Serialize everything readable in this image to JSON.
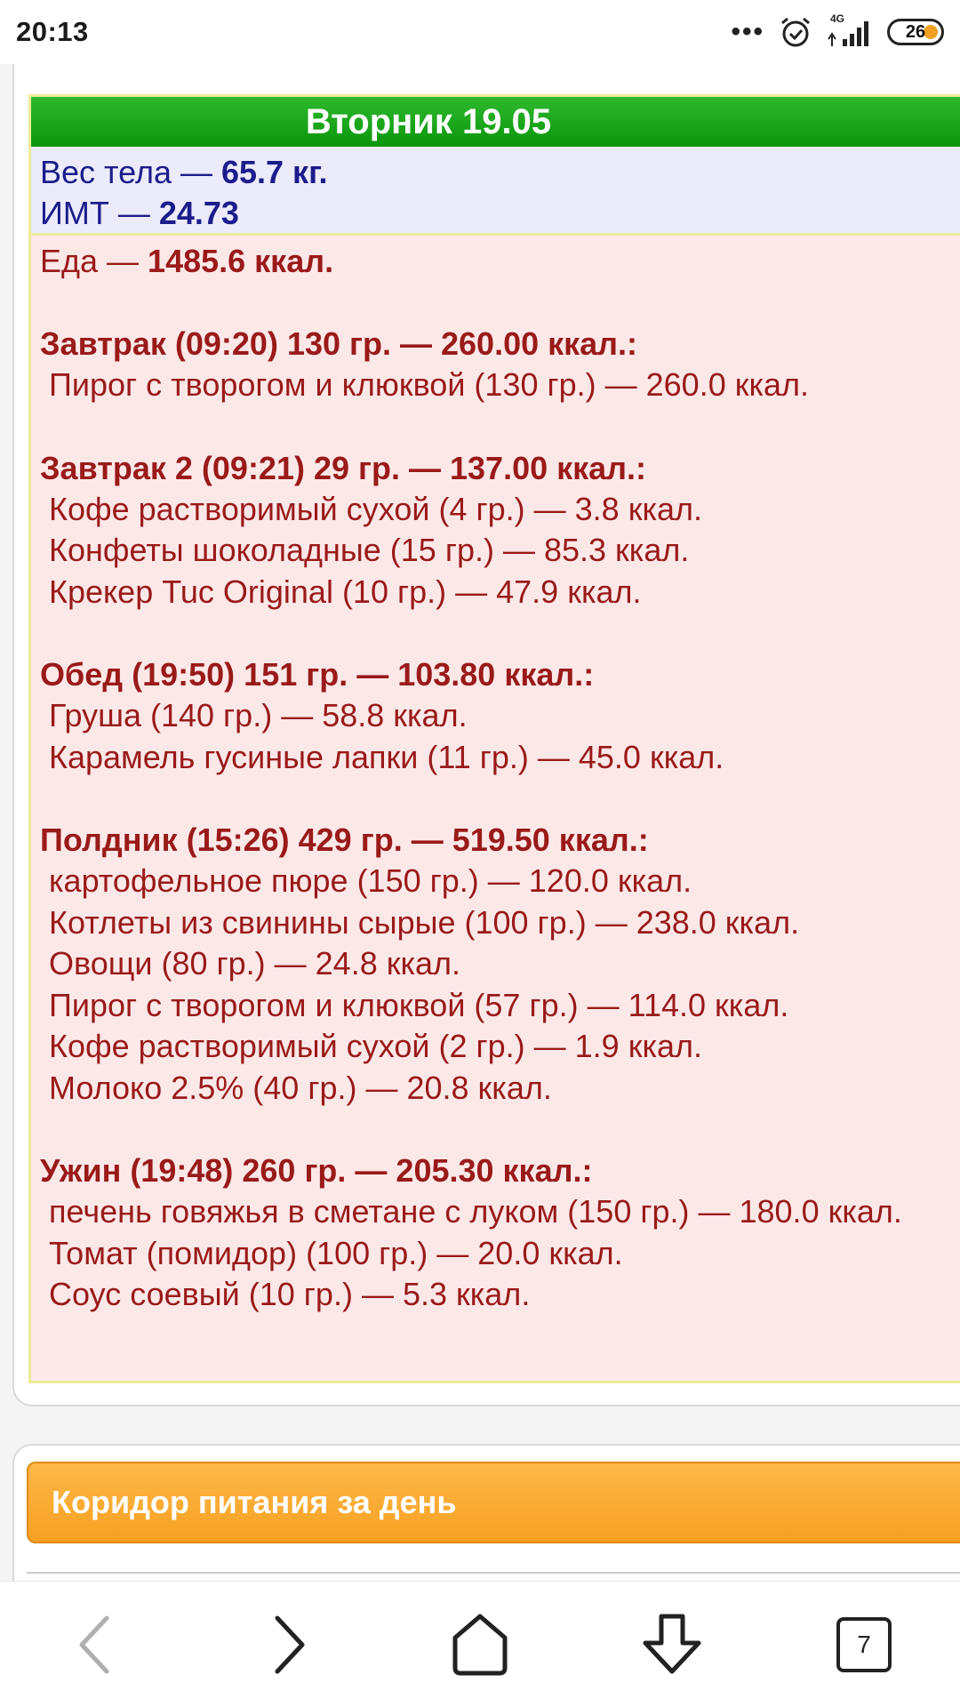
{
  "status_bar": {
    "time": "20:13",
    "network": "4G",
    "battery": "26"
  },
  "day": {
    "title": "Вторник 19.05",
    "weight_label": "Вес тела — ",
    "weight_value": "65.7 кг.",
    "bmi_label": "ИМТ — ",
    "bmi_value": "24.73",
    "food_label": "Еда — ",
    "food_total": "1485.6 ккал.",
    "meals": [
      {
        "title": "Завтрак (09:20) 130 гр. — 260.00 ккал.:",
        "items": [
          "Пирог с творогом и клюквой (130 гр.) — 260.0 ккал."
        ]
      },
      {
        "title": "Завтрак 2 (09:21) 29 гр. — 137.00 ккал.:",
        "items": [
          "Кофе растворимый сухой (4 гр.) — 3.8 ккал.",
          "Конфеты шоколадные (15 гр.) — 85.3 ккал.",
          "Крекер Tuc Original (10 гр.) — 47.9 ккал."
        ]
      },
      {
        "title": "Обед (19:50) 151 гр. — 103.80 ккал.:",
        "items": [
          "Груша (140 гр.) — 58.8 ккал.",
          "Карамель гусиные лапки (11 гр.) — 45.0 ккал."
        ]
      },
      {
        "title": "Полдник (15:26) 429 гр. — 519.50 ккал.:",
        "items": [
          "картофельное пюре (150 гр.) — 120.0 ккал.",
          "Котлеты из свинины сырые (100 гр.) — 238.0 ккал.",
          "Овощи (80 гр.) — 24.8 ккал.",
          "Пирог с творогом и клюквой (57 гр.) — 114.0 ккал.",
          "Кофе растворимый сухой (2 гр.) — 1.9 ккал.",
          "Молоко 2.5% (40 гр.) — 20.8 ккал."
        ]
      },
      {
        "title": "Ужин (19:48) 260 гр. — 205.30 ккал.:",
        "items": [
          "печень говяжья в сметане с луком (150 гр.) — 180.0 ккал.",
          "Томат (помидор) (100 гр.) — 20.0 ккал.",
          "Соус соевый (10 гр.) — 5.3 ккал."
        ]
      }
    ]
  },
  "corridor": {
    "title": "Коридор питания за день"
  },
  "nav": {
    "tab_count": "7",
    "icons": [
      "back-icon",
      "forward-icon",
      "home-icon",
      "download-icon",
      "tabs-icon"
    ]
  },
  "colors": {
    "header_green": "#0a960a",
    "food_red": "#9a1a1a",
    "stats_blue": "#1c1c8c",
    "corridor_orange": "#f5a020"
  }
}
